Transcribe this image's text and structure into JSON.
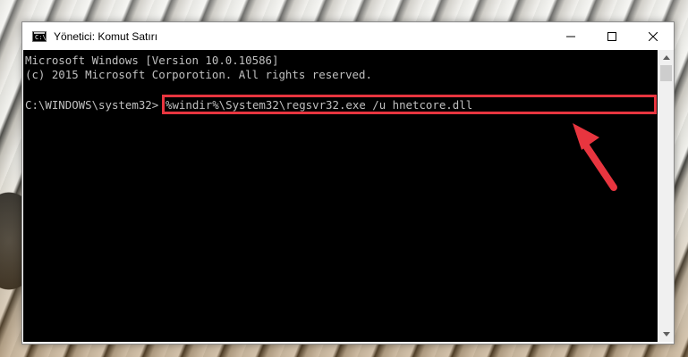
{
  "window": {
    "title": "Yönetici: Komut Satırı",
    "icon": "cmd-icon",
    "controls": [
      "minimize-icon",
      "maximize-icon",
      "close-icon"
    ]
  },
  "console": {
    "lines": [
      "Microsoft Windows [Version 10.0.10586]",
      "(c) 2015 Microsoft Corporotion. All rights reserved."
    ],
    "prompt": "C:\\WINDOWS\\system32>",
    "command": "%windir%\\System32\\regsvr32.exe /u hnetcore.dll"
  },
  "annotation": {
    "highlight_color": "#e8353f",
    "arrow_color": "#e8353f"
  }
}
